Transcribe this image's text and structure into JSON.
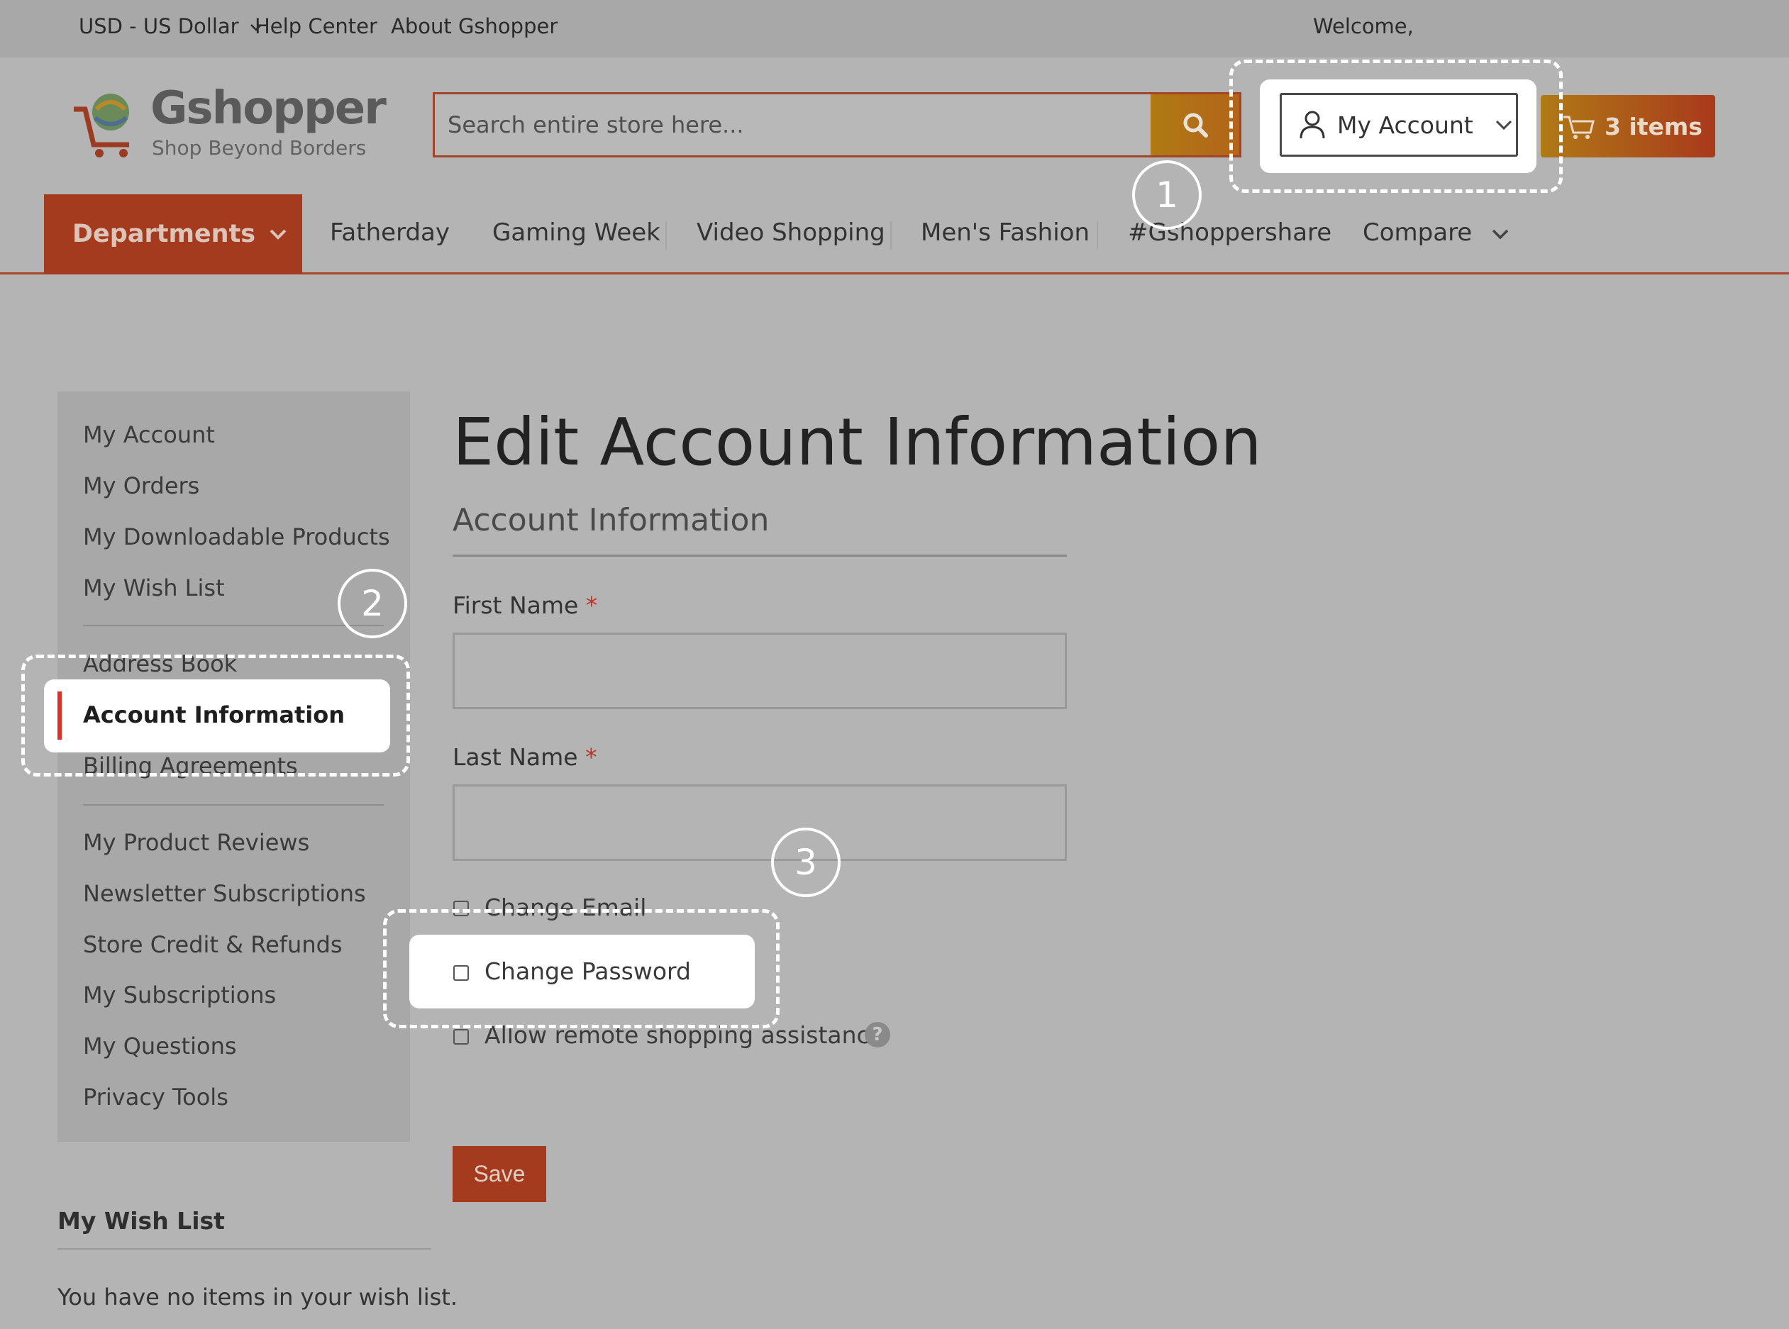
{
  "topbar": {
    "currency": "USD - US Dollar",
    "help_center": "Help Center",
    "about": "About Gshopper",
    "welcome": "Welcome,"
  },
  "header": {
    "logo_name": "Gshopper",
    "logo_tagline": "Shop Beyond Borders",
    "search_placeholder": "Search entire store here...",
    "account_label": "My Account",
    "cart_label": "3 items"
  },
  "nav": {
    "departments": "Departments",
    "items": [
      "Fatherday",
      "Gaming Week",
      "Video Shopping",
      "Men's Fashion",
      "#Gshoppershare",
      "Compare"
    ]
  },
  "sidebar": {
    "group1": [
      "My Account",
      "My Orders",
      "My Downloadable Products",
      "My Wish List"
    ],
    "group2": [
      "Address Book",
      "Account Information",
      "Billing Agreements"
    ],
    "group3": [
      "My Product Reviews",
      "Newsletter Subscriptions",
      "Store Credit & Refunds",
      "My Subscriptions",
      "My Questions",
      "Privacy Tools"
    ],
    "active": "Account Information"
  },
  "main": {
    "title": "Edit Account Information",
    "section": "Account Information",
    "first_name_label": "First Name",
    "last_name_label": "Last Name",
    "required_mark": "*",
    "change_email": "Change Email",
    "change_password": "Change Password",
    "remote_assist": "Allow remote shopping assistance",
    "help_glyph": "?",
    "save": "Save"
  },
  "wishlist": {
    "title": "My Wish List",
    "empty_message": "You have no items in your wish list."
  },
  "annotations": [
    "1",
    "2",
    "3"
  ],
  "colors": {
    "brand_red": "#a53b1e",
    "accent_orange": "#b07a14",
    "active_bar": "#d9342a"
  }
}
